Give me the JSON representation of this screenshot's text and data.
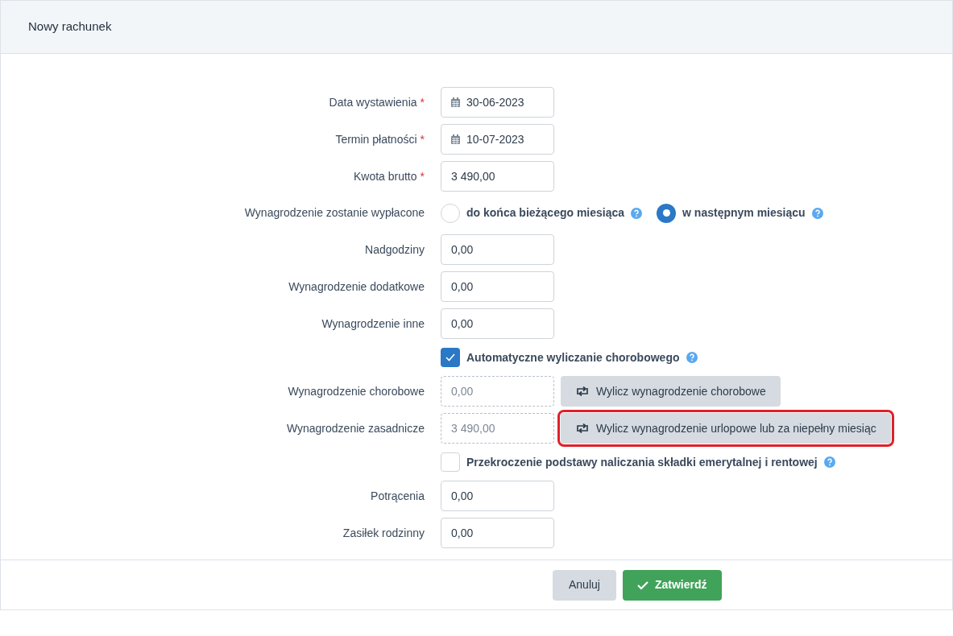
{
  "dialog": {
    "title": "Nowy rachunek"
  },
  "rows": [
    {
      "kind": "date",
      "label": "Data wystawienia",
      "required_mark": "*",
      "value": "30-06-2023"
    },
    {
      "kind": "date",
      "label": "Termin płatności",
      "required_mark": "*",
      "value": "10-07-2023"
    },
    {
      "kind": "text",
      "label": "Kwota brutto",
      "required_mark": "*",
      "value": "3 490,00"
    },
    {
      "kind": "radio",
      "label": "Wynagrodzenie zostanie wypłacone",
      "options": [
        {
          "label": "do końca bieżącego miesiąca",
          "selected": false
        },
        {
          "label": "w następnym miesiącu",
          "selected": true
        }
      ]
    },
    {
      "kind": "text",
      "label": "Nadgodziny",
      "value": "0,00"
    },
    {
      "kind": "text",
      "label": "Wynagrodzenie dodatkowe",
      "value": "0,00"
    },
    {
      "kind": "text",
      "label": "Wynagrodzenie inne",
      "value": "0,00"
    },
    {
      "kind": "checkbox",
      "label": "Automatyczne wyliczanie chorobowego",
      "checked": true
    },
    {
      "kind": "computed",
      "label": "Wynagrodzenie chorobowe",
      "value": "0,00",
      "button": "Wylicz wynagrodzenie chorobowe",
      "highlighted": false
    },
    {
      "kind": "computed",
      "label": "Wynagrodzenie zasadnicze",
      "value": "3 490,00",
      "button": "Wylicz wynagrodzenie urlopowe lub za niepełny miesiąc",
      "highlighted": true
    },
    {
      "kind": "checkbox",
      "label": "Przekroczenie podstawy naliczania składki emerytalnej i rentowej",
      "checked": false
    },
    {
      "kind": "text",
      "label": "Potrącenia",
      "value": "0,00"
    },
    {
      "kind": "text",
      "label": "Zasiłek rodzinny",
      "value": "0,00"
    }
  ],
  "footer": {
    "cancel": "Anuluj",
    "confirm": "Zatwierdź"
  }
}
